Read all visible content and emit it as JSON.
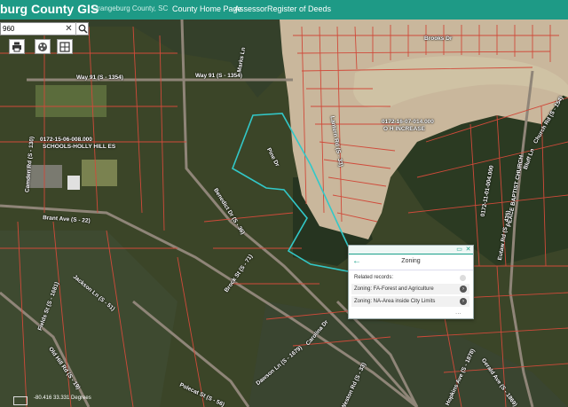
{
  "header": {
    "app_title": "burg County GIS",
    "subtitle": "Orangeburg County, SC",
    "nav": [
      "County Home Page",
      "Assessor",
      "Register of Deeds"
    ]
  },
  "search": {
    "value": "960",
    "clear_glyph": "✕",
    "icon": "search-icon"
  },
  "toolbar": {
    "icons": [
      "print-icon",
      "basemap-icon",
      "layers-icon"
    ]
  },
  "map_labels": {
    "way91_a": "Way 91 (S - 1354)",
    "way91_b": "Way 91 (S - 1354)",
    "brooks": "Brooks Dr",
    "parcel_sub": "0172-16-07-014.000",
    "parcel_sub2": "O H INCREASE",
    "schools": "0172-15-06-008.000",
    "schools2": "SCHOOLS-HOLLY HILL ES",
    "parcel_ne": "0172-11-01-004.000",
    "parcel_ne2": "PEACE BAPTIST CHURCH",
    "brant": "Brant Ave (S - 22)",
    "benedict": "Benedict Dr (S - 36)",
    "brock": "Brock St (S - 71)",
    "dawson": "Dawson Ln (S - 1679)",
    "jackson": "Jackson Ln (S - 51)",
    "fields": "Fields St (S - 1681)",
    "polecat": "Polecat St (S - 56)",
    "oldhill": "Old Hill Rd (S - 19)",
    "carolina": "Carolina Dr",
    "weston": "Weston Rd (S - 33)",
    "hopkins": "Hopkins Ave (S - 1878)",
    "lantern": "Lantern Rd (S - 33)",
    "gerald": "Gerald Ave (S - 1869)",
    "eutaw": "Eutaw Rd (S - 435)",
    "bluff": "Bluff Ln",
    "camden": "Camden Rd (S - 130)",
    "church": "Church Rd (S - 154)",
    "marks": "Marks Ln",
    "pine": "Pine Dr"
  },
  "popup": {
    "title": "Zoning",
    "related_label": "Related records:",
    "records": [
      "Zoning: FA-Forest and Agriculture",
      "Zoning: NA-Area inside City Limits"
    ],
    "more": "..."
  },
  "status": {
    "coordinates": "-80.416 33.331 Degrees"
  },
  "colors": {
    "header": "#1e9a86",
    "parcel_line": "#d04a3a",
    "selection": "#32c8c8",
    "pond": "#c8b898"
  }
}
